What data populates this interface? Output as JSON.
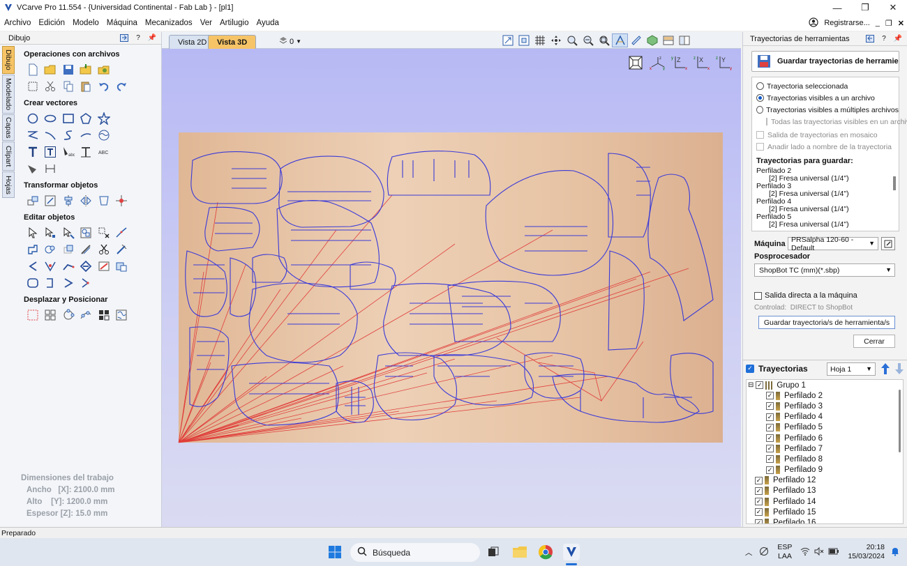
{
  "window": {
    "title": "VCarve Pro 11.554 - {Universidad Continental - Fab Lab } - [pl1]",
    "minimize": "—",
    "maximize": "❐",
    "close": "✕"
  },
  "menu": {
    "items": [
      "Archivo",
      "Edición",
      "Modelo",
      "Máquina",
      "Mecanizados",
      "Ver",
      "Artilugio",
      "Ayuda"
    ],
    "register": "Registrarse..."
  },
  "left_panel": {
    "header": "Dibujo",
    "tabs": [
      "Dibujo",
      "Modelado",
      "Capas",
      "Clipart",
      "Hojas"
    ],
    "sections": {
      "files": "Operaciones con archivos",
      "vectors": "Crear vectores",
      "transform": "Transformar objetos",
      "edit": "Editar objetos",
      "move": "Desplazar y Posicionar"
    },
    "job": {
      "title": "Dimensiones del trabajo",
      "width": "Ancho   [X]: 2100.0 mm",
      "height": "Alto    [Y]: 1200.0 mm",
      "thickness": "Espesor [Z]: 15.0 mm"
    }
  },
  "view": {
    "tab_2d": "Vista 2D",
    "tab_3d": "Vista 3D",
    "layer": "0",
    "orientation_labels": [
      "X",
      "Z",
      "X",
      "Y"
    ]
  },
  "right_panel": {
    "header": "Trayectorias de herramientas",
    "save_title": "Guardar trayectorias de herramier",
    "options": [
      {
        "label": "Trayectoria seleccionada",
        "type": "radio",
        "on": false
      },
      {
        "label": "Trayectorias visibles a un archivo",
        "type": "radio",
        "on": true
      },
      {
        "label": "Trayectorias visibles a múltiples archivos",
        "type": "radio",
        "on": false
      }
    ],
    "sub_options": [
      "Todas las trayectorias visibles en un archivo",
      "Salida de trayectorias en mosaico",
      "Anadir lado a nombre de la trayectoria"
    ],
    "list_title": "Trayectorias para guardar:",
    "list": [
      {
        "name": "Perfilado 2",
        "tool": "[2] Fresa universal (1/4\")"
      },
      {
        "name": "Perfilado 3",
        "tool": "[2] Fresa universal (1/4\")"
      },
      {
        "name": "Perfilado 4",
        "tool": "[2] Fresa universal (1/4\")"
      },
      {
        "name": "Perfilado 5",
        "tool": "[2] Fresa universal (1/4\")"
      }
    ],
    "machine_label": "Máquina",
    "machine_value": "PRSalpha 120-60 - Default",
    "post_label": "Posprocesador",
    "post_value": "ShopBot TC (mm)(*.sbp)",
    "direct_label": "Salida directa a la máquina",
    "controlled": "Controlad:  DIRECT to ShopBot",
    "save_button": "Guardar trayectoria/s de herramienta/s",
    "close_button": "Cerrar",
    "traj_title": "Trayectorias",
    "sheet_value": "Hoja 1",
    "tree": [
      {
        "label": "Grupo 1",
        "level": 0,
        "group": true
      },
      {
        "label": "Perfilado 2",
        "level": 1
      },
      {
        "label": "Perfilado 3",
        "level": 1
      },
      {
        "label": "Perfilado 4",
        "level": 1
      },
      {
        "label": "Perfilado 5",
        "level": 1
      },
      {
        "label": "Perfilado 6",
        "level": 1
      },
      {
        "label": "Perfilado 7",
        "level": 1
      },
      {
        "label": "Perfilado 8",
        "level": 1
      },
      {
        "label": "Perfilado 9",
        "level": 1
      },
      {
        "label": "Perfilado 12",
        "level": 0
      },
      {
        "label": "Perfilado 13",
        "level": 0
      },
      {
        "label": "Perfilado 14",
        "level": 0
      },
      {
        "label": "Perfilado 15",
        "level": 0
      },
      {
        "label": "Perfilado 16",
        "level": 0
      }
    ]
  },
  "status": {
    "text": "Preparado"
  },
  "taskbar": {
    "search": "Búsqueda",
    "lang1": "ESP",
    "lang2": "LAA",
    "time": "20:18",
    "date": "15/03/2024"
  },
  "colors": {
    "accent_tab": "#f6c467",
    "toolpath": "#3a3ad8",
    "rapid": "#e03030"
  }
}
